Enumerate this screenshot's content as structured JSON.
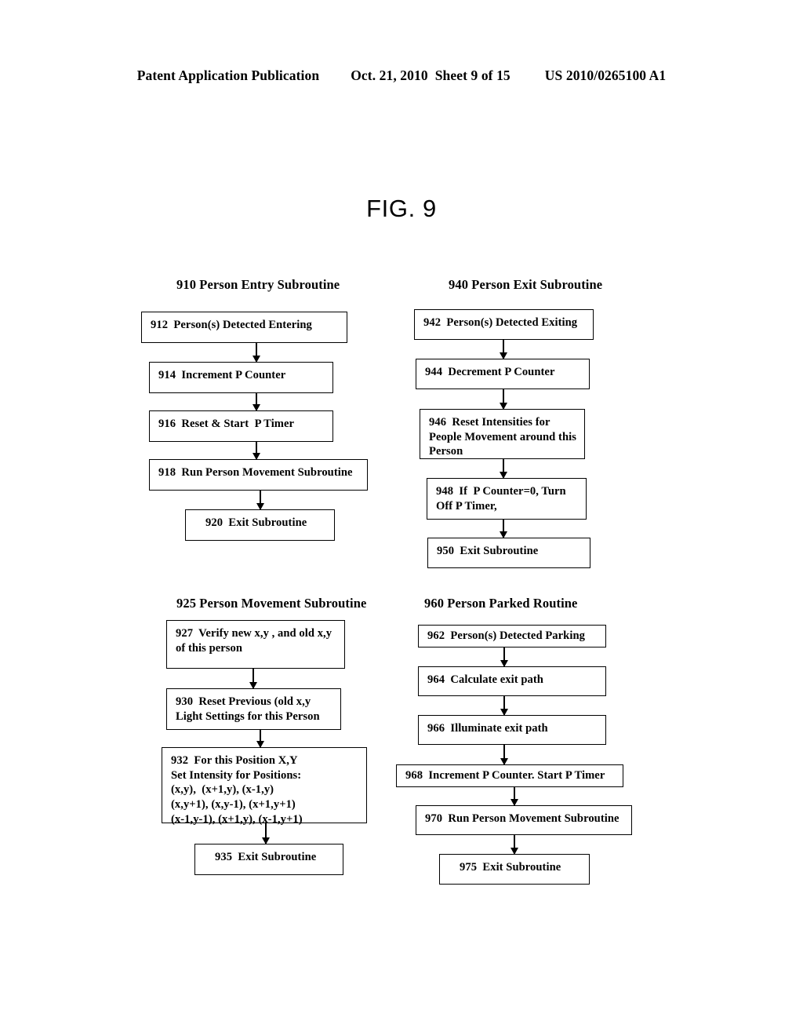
{
  "header": {
    "publication": "Patent Application Publication",
    "date": "Oct. 21, 2010",
    "sheet": "Sheet 9 of 15",
    "patent_number": "US 2010/0265100 A1"
  },
  "figure": {
    "title": "FIG. 9"
  },
  "charts": [
    {
      "id": "person-entry-subroutine",
      "title": "910  Person Entry Subroutine",
      "nodes": [
        {
          "id": "912",
          "lines": [
            "912  Person(s) Detected Entering"
          ]
        },
        {
          "id": "914",
          "lines": [
            "914  Increment P Counter"
          ]
        },
        {
          "id": "916",
          "lines": [
            "916  Reset & Start  P Timer"
          ]
        },
        {
          "id": "918",
          "lines": [
            "918  Run Person Movement Subroutine"
          ]
        },
        {
          "id": "920",
          "lines": [
            "920  Exit Subroutine"
          ]
        }
      ]
    },
    {
      "id": "person-exit-subroutine",
      "title": "940  Person Exit Subroutine",
      "nodes": [
        {
          "id": "942",
          "lines": [
            "942  Person(s) Detected Exiting"
          ]
        },
        {
          "id": "944",
          "lines": [
            "944  Decrement P Counter"
          ]
        },
        {
          "id": "946",
          "lines": [
            "946  Reset Intensities for",
            "People Movement around this",
            "Person"
          ]
        },
        {
          "id": "948",
          "lines": [
            "948  If  P Counter=0, Turn",
            "Off P Timer,"
          ]
        },
        {
          "id": "950",
          "lines": [
            "950  Exit Subroutine"
          ]
        }
      ]
    },
    {
      "id": "person-movement-subroutine",
      "title": "925  Person Movement Subroutine",
      "nodes": [
        {
          "id": "927",
          "lines": [
            "927  Verify new x,y , and old x,y",
            "of this person"
          ]
        },
        {
          "id": "930",
          "lines": [
            "930  Reset Previous (old x,y",
            "Light Settings for this Person"
          ]
        },
        {
          "id": "932",
          "lines": [
            "932  For this Position X,Y",
            "Set Intensity for Positions:",
            "(x,y),  (x+1,y), (x-1,y)",
            "(x,y+1), (x,y-1), (x+1,y+1)",
            "(x-1,y-1), (x+1,y), (x-1,y+1)"
          ]
        },
        {
          "id": "935",
          "lines": [
            "935  Exit Subroutine"
          ]
        }
      ]
    },
    {
      "id": "person-parked-routine",
      "title": "960  Person Parked Routine",
      "nodes": [
        {
          "id": "962",
          "lines": [
            "962  Person(s) Detected Parking"
          ]
        },
        {
          "id": "964",
          "lines": [
            "964  Calculate exit path"
          ]
        },
        {
          "id": "966",
          "lines": [
            "966  Illuminate exit path"
          ]
        },
        {
          "id": "968",
          "lines": [
            "968  Increment P Counter. Start P Timer"
          ]
        },
        {
          "id": "970",
          "lines": [
            "970  Run Person Movement Subroutine"
          ]
        },
        {
          "id": "975",
          "lines": [
            "975  Exit Subroutine"
          ]
        }
      ]
    }
  ]
}
